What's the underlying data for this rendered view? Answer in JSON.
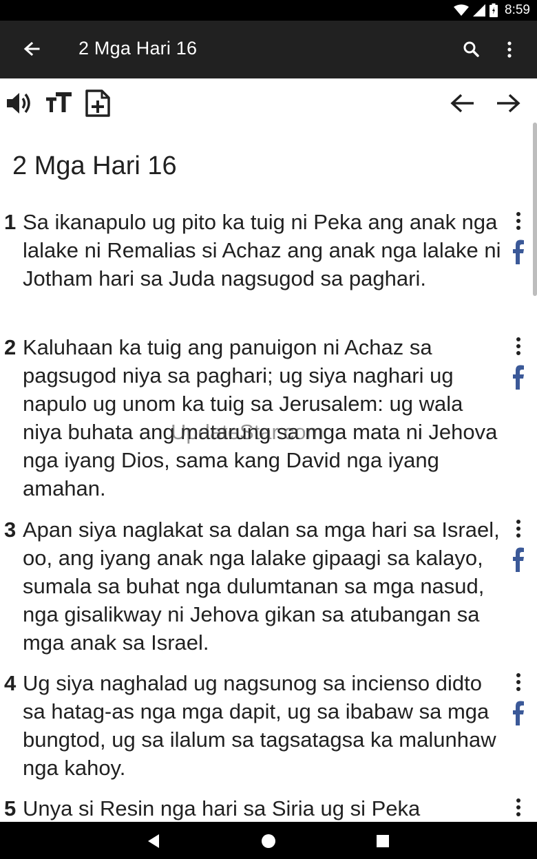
{
  "status": {
    "time": "8:59"
  },
  "app_bar": {
    "title": "2 Mga Hari 16"
  },
  "toolbar": {
    "left_icons": [
      "volume-icon",
      "text-size-icon",
      "add-note-icon"
    ],
    "right_icons": [
      "arrow-left-icon",
      "arrow-right-icon"
    ]
  },
  "chapter": {
    "title": "2 Mga Hari 16"
  },
  "verses": [
    {
      "num": "1",
      "text": "Sa ikanapulo ug pito ka tuig ni Peka ang anak nga lalake ni Remalias si Achaz ang anak nga lalake ni Jotham hari sa Juda nagsugod sa paghari."
    },
    {
      "num": "2",
      "text": "Kaluhaan ka tuig ang panuigon ni Achaz sa pagsugod niya sa paghari; ug siya naghari ug napulo ug unom ka tuig sa Jerusalem: ug wala niya buhata ang matarung sa mga mata ni Jehova nga iyang Dios, sama kang David nga iyang amahan."
    },
    {
      "num": "3",
      "text": "Apan siya naglakat sa dalan sa mga hari sa Israel, oo, ang iyang anak nga lalake gipaagi sa kalayo, sumala sa buhat nga dulumtanan sa mga nasud, nga gisalikway ni Jehova gikan sa atubangan sa mga anak sa Israel."
    },
    {
      "num": "4",
      "text": "Ug siya naghalad ug nagsunog sa incienso didto sa hatag-as nga mga dapit, ug sa ibabaw sa mga bungtod, ug sa ilalum sa tagsatagsa ka malunhaw nga kahoy."
    },
    {
      "num": "5",
      "text": "Unya si Resin nga hari sa Siria ug si Peka"
    }
  ],
  "watermark": "UpdateStar.com",
  "colors": {
    "app_bar": "#212121",
    "status_bar": "#000000",
    "facebook": "#3b5998",
    "text": "#212121"
  }
}
